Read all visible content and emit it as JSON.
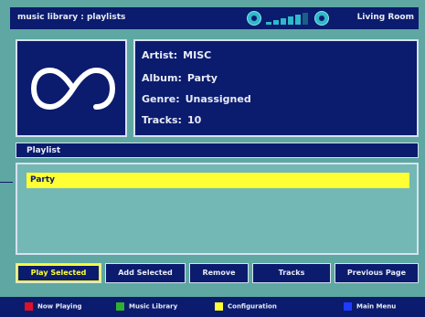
{
  "header": {
    "title": "music library : playlists",
    "room": "Living Room",
    "volume_level": 0.7
  },
  "album": {
    "art_icon": "loop-icon",
    "artist_label": "Artist:",
    "artist": "MISC",
    "album_label": "Album:",
    "album": "Party",
    "genre_label": "Genre:",
    "genre": "Unassigned",
    "tracks_label": "Tracks:",
    "tracks": "10"
  },
  "playlist": {
    "header": "Playlist",
    "items": [
      {
        "label": "Party"
      }
    ]
  },
  "buttons": [
    {
      "label": "Play Selected"
    },
    {
      "label": "Add Selected"
    },
    {
      "label": "Remove"
    },
    {
      "label": "Tracks"
    },
    {
      "label": "Previous Page"
    }
  ],
  "legend": [
    {
      "label": "Now Playing",
      "color": "#e0102a"
    },
    {
      "label": "Music Library",
      "color": "#2fb12f"
    },
    {
      "label": "Configuration",
      "color": "#ffff33"
    },
    {
      "label": "Main Menu",
      "color": "#1f3bff"
    }
  ],
  "colors": {
    "panel": "#0b1b6e",
    "background": "#5fa7a2",
    "highlight": "#ffff33"
  }
}
